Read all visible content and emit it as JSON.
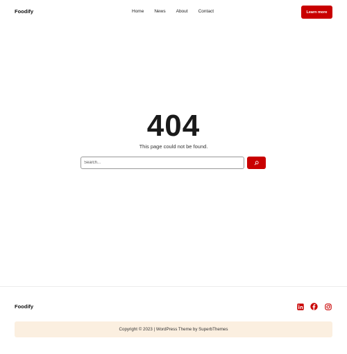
{
  "header": {
    "brand": "Foodify",
    "nav": [
      {
        "label": "Home"
      },
      {
        "label": "News"
      },
      {
        "label": "About"
      },
      {
        "label": "Contact"
      }
    ],
    "cta_label": "Learn more"
  },
  "main": {
    "error_code": "404",
    "message": "This page could not be found.",
    "search": {
      "placeholder": "Search...",
      "value": "",
      "button_icon": "search-icon"
    }
  },
  "footer": {
    "brand": "Foodify",
    "social_icons": [
      "linkedin-icon",
      "facebook-icon",
      "instagram-icon"
    ],
    "copyright": "Copyright © 2023 | WordPress Theme by SuperbThemes"
  },
  "colors": {
    "accent": "#c90000",
    "copyright_bg": "#fbefe0",
    "text": "#1a1a1a"
  }
}
